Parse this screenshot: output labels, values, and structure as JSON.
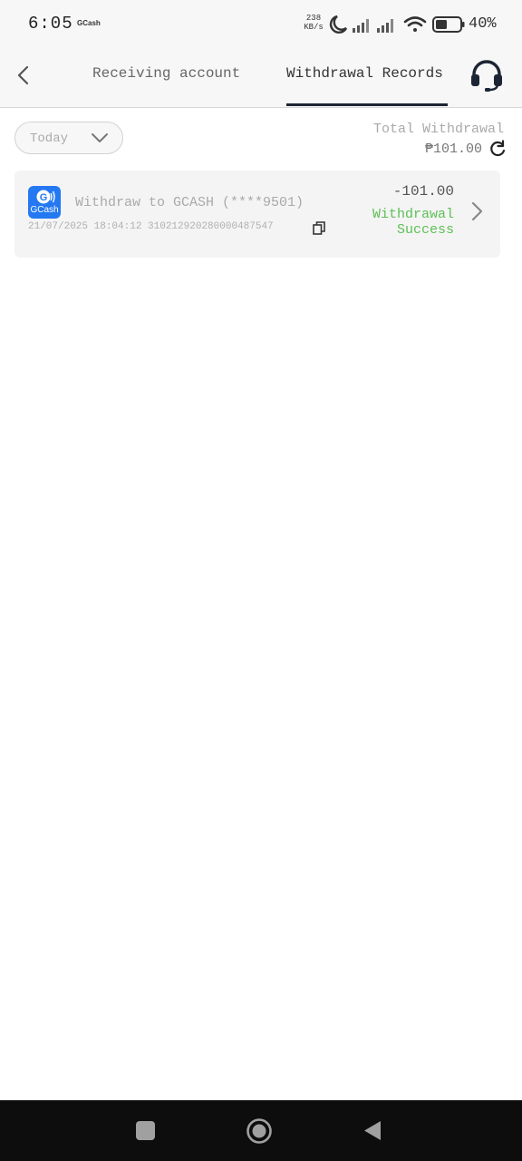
{
  "status_bar": {
    "time": "6:05",
    "app_label": "GCash",
    "speed_value": "238",
    "speed_unit": "KB/s",
    "battery": "40%",
    "icons": [
      "moon-icon",
      "signal-icon",
      "signal-icon",
      "wifi-icon",
      "battery-icon"
    ]
  },
  "header": {
    "tabs": [
      {
        "label": "Receiving account",
        "active": false
      },
      {
        "label": "Withdrawal Records",
        "active": true
      }
    ],
    "back_icon": "chevron-left-icon",
    "support_icon": "headset-icon"
  },
  "filter": {
    "date_label": "Today",
    "total_label": "Total Withdrawal",
    "total_amount": "₱101.00"
  },
  "records": [
    {
      "title": "Withdraw to GCASH (****9501)",
      "date": "21/07/2025 18:04:12",
      "reference": "310212920280000487547",
      "amount": "-101.00",
      "status": "Withdrawal Success",
      "logo_text": "GCash",
      "logo_letter": "G"
    }
  ],
  "colors": {
    "status_success": "#5dc056",
    "logo_blue": "#2478f2",
    "tab_indicator": "#1c2533",
    "nav_bar": "#0d0d0d"
  }
}
